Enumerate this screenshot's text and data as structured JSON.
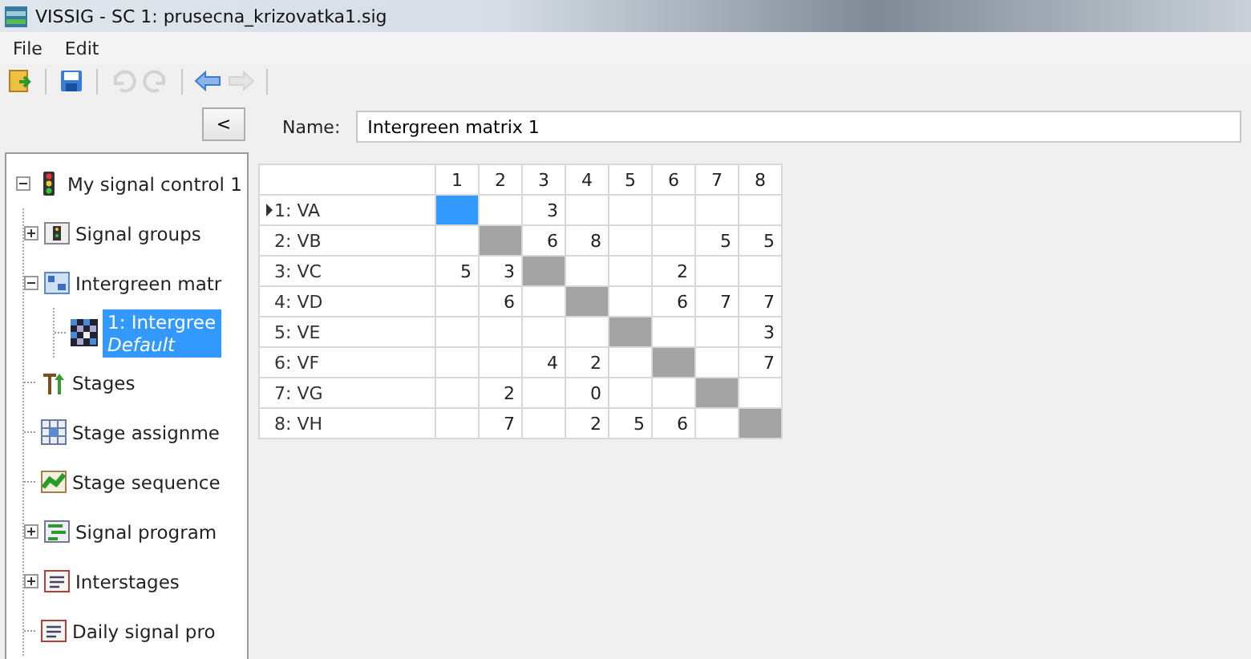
{
  "window": {
    "title": "VISSIG - SC 1: prusecna_krizovatka1.sig"
  },
  "menu": [
    "File",
    "Edit"
  ],
  "toolbar": [
    {
      "items": [
        {
          "kind": "open",
          "disabled": false
        }
      ]
    },
    {
      "items": [
        {
          "kind": "save",
          "disabled": false
        }
      ]
    },
    {
      "items": [
        {
          "kind": "undo",
          "disabled": true
        },
        {
          "kind": "redo",
          "disabled": true
        }
      ]
    },
    {
      "items": [
        {
          "kind": "back",
          "disabled": false
        },
        {
          "kind": "forward",
          "disabled": true
        }
      ]
    }
  ],
  "collapse_button": "<",
  "tree": [
    {
      "label": "My signal control 1",
      "kind": "controller",
      "expanded": true,
      "selected": false,
      "children": [
        {
          "label": "Signal groups",
          "kind": "signal-groups",
          "expanded": false,
          "selected": false
        },
        {
          "label": "Intergreen matr",
          "kind": "intergreen",
          "expanded": true,
          "selected": false,
          "children": [
            {
              "label": "1: Intergree",
              "sublabel": "Default",
              "kind": "matrix",
              "selected": true
            }
          ]
        },
        {
          "label": "Stages",
          "kind": "stages",
          "selected": false
        },
        {
          "label": "Stage assignme",
          "kind": "assignment",
          "selected": false
        },
        {
          "label": "Stage sequence",
          "kind": "sequence",
          "selected": false
        },
        {
          "label": "Signal program",
          "kind": "program",
          "expanded": false,
          "selected": false
        },
        {
          "label": "Interstages",
          "kind": "document",
          "expanded": false,
          "selected": false
        },
        {
          "label": "Daily signal pro",
          "kind": "document",
          "selected": false
        }
      ]
    }
  ],
  "name_field": {
    "label": "Name:",
    "value": "Intergreen matrix 1"
  },
  "matrix": {
    "columns": [
      "1",
      "2",
      "3",
      "4",
      "5",
      "6",
      "7",
      "8"
    ],
    "rows": [
      {
        "label": "1: VA",
        "current": true,
        "cells": [
          {
            "disabled": false,
            "selected": true
          },
          {
            "disabled": false,
            "selected": false
          },
          {
            "value": "3",
            "disabled": false,
            "selected": false
          },
          {
            "disabled": false,
            "selected": false
          },
          {
            "disabled": false,
            "selected": false
          },
          {
            "disabled": false,
            "selected": false
          },
          {
            "disabled": false,
            "selected": false
          },
          {
            "disabled": false,
            "selected": false
          }
        ]
      },
      {
        "label": "2: VB",
        "current": false,
        "cells": [
          {
            "disabled": false,
            "selected": false
          },
          {
            "disabled": true,
            "selected": false
          },
          {
            "value": "6",
            "disabled": false,
            "selected": false
          },
          {
            "value": "8",
            "disabled": false,
            "selected": false
          },
          {
            "disabled": false,
            "selected": false
          },
          {
            "disabled": false,
            "selected": false
          },
          {
            "value": "5",
            "disabled": false,
            "selected": false
          },
          {
            "value": "5",
            "disabled": false,
            "selected": false
          }
        ]
      },
      {
        "label": "3: VC",
        "current": false,
        "cells": [
          {
            "value": "5",
            "disabled": false,
            "selected": false
          },
          {
            "value": "3",
            "disabled": false,
            "selected": false
          },
          {
            "disabled": true,
            "selected": false
          },
          {
            "disabled": false,
            "selected": false
          },
          {
            "disabled": false,
            "selected": false
          },
          {
            "value": "2",
            "disabled": false,
            "selected": false
          },
          {
            "disabled": false,
            "selected": false
          },
          {
            "disabled": false,
            "selected": false
          }
        ]
      },
      {
        "label": "4: VD",
        "current": false,
        "cells": [
          {
            "disabled": false,
            "selected": false
          },
          {
            "value": "6",
            "disabled": false,
            "selected": false
          },
          {
            "disabled": false,
            "selected": false
          },
          {
            "disabled": true,
            "selected": false
          },
          {
            "disabled": false,
            "selected": false
          },
          {
            "value": "6",
            "disabled": false,
            "selected": false
          },
          {
            "value": "7",
            "disabled": false,
            "selected": false
          },
          {
            "value": "7",
            "disabled": false,
            "selected": false
          }
        ]
      },
      {
        "label": "5: VE",
        "current": false,
        "cells": [
          {
            "disabled": false,
            "selected": false
          },
          {
            "disabled": false,
            "selected": false
          },
          {
            "disabled": false,
            "selected": false
          },
          {
            "disabled": false,
            "selected": false
          },
          {
            "disabled": true,
            "selected": false
          },
          {
            "disabled": false,
            "selected": false
          },
          {
            "disabled": false,
            "selected": false
          },
          {
            "value": "3",
            "disabled": false,
            "selected": false
          }
        ]
      },
      {
        "label": "6: VF",
        "current": false,
        "cells": [
          {
            "disabled": false,
            "selected": false
          },
          {
            "disabled": false,
            "selected": false
          },
          {
            "value": "4",
            "disabled": false,
            "selected": false
          },
          {
            "value": "2",
            "disabled": false,
            "selected": false
          },
          {
            "disabled": false,
            "selected": false
          },
          {
            "disabled": true,
            "selected": false
          },
          {
            "disabled": false,
            "selected": false
          },
          {
            "value": "7",
            "disabled": false,
            "selected": false
          }
        ]
      },
      {
        "label": "7: VG",
        "current": false,
        "cells": [
          {
            "disabled": false,
            "selected": false
          },
          {
            "value": "2",
            "disabled": false,
            "selected": false
          },
          {
            "disabled": false,
            "selected": false
          },
          {
            "value": "0",
            "disabled": false,
            "selected": false
          },
          {
            "disabled": false,
            "selected": false
          },
          {
            "disabled": false,
            "selected": false
          },
          {
            "disabled": true,
            "selected": false
          },
          {
            "disabled": false,
            "selected": false
          }
        ]
      },
      {
        "label": "8: VH",
        "current": false,
        "cells": [
          {
            "disabled": false,
            "selected": false
          },
          {
            "value": "7",
            "disabled": false,
            "selected": false
          },
          {
            "disabled": false,
            "selected": false
          },
          {
            "value": "2",
            "disabled": false,
            "selected": false
          },
          {
            "value": "5",
            "disabled": false,
            "selected": false
          },
          {
            "value": "6",
            "disabled": false,
            "selected": false
          },
          {
            "disabled": false,
            "selected": false
          },
          {
            "disabled": true,
            "selected": false
          }
        ]
      }
    ]
  }
}
